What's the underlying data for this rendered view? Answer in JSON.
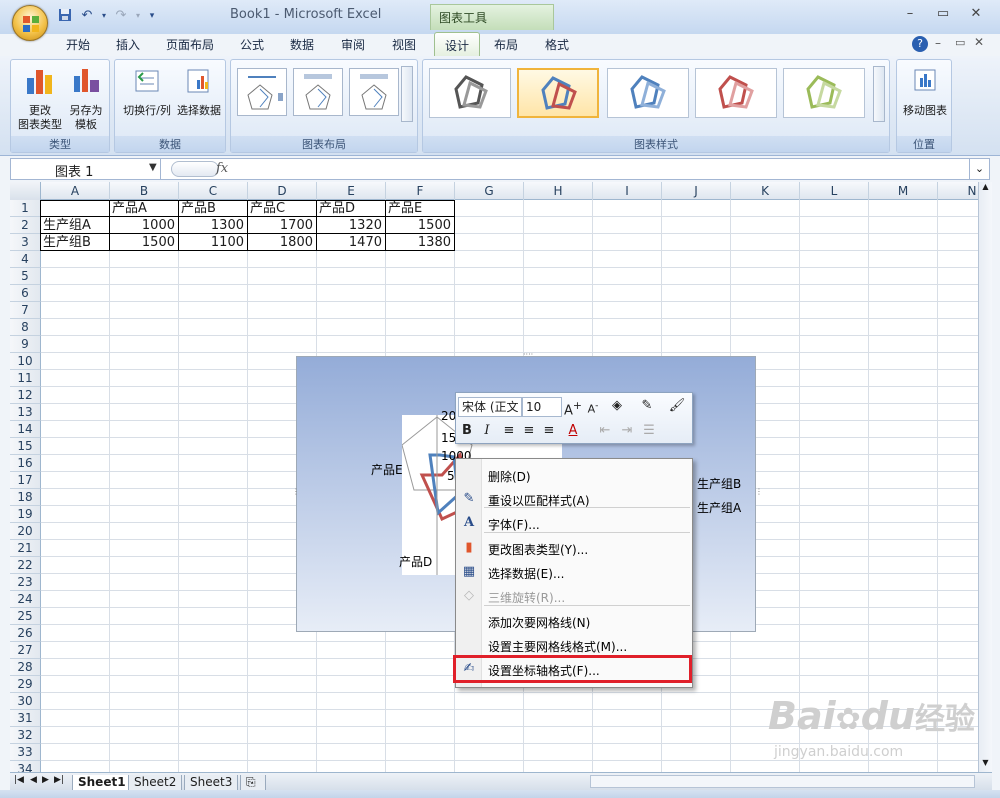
{
  "window": {
    "title": "Book1 - Microsoft Excel",
    "tools_tab": "图表工具"
  },
  "tabs": [
    "开始",
    "插入",
    "页面布局",
    "公式",
    "数据",
    "审阅",
    "视图",
    "设计",
    "布局",
    "格式"
  ],
  "ribbon": {
    "type_group": {
      "label": "类型",
      "change_type": "更改\n图表类型",
      "save_template": "另存为\n模板"
    },
    "data_group": {
      "label": "数据",
      "switch_row_col": "切换行/列",
      "select_data": "选择数据"
    },
    "layout_group": {
      "label": "图表布局"
    },
    "styles_group": {
      "label": "图表样式"
    },
    "location_group": {
      "label": "位置",
      "move_chart": "移动图表"
    }
  },
  "formula_bar": {
    "name_box": "图表 1",
    "fx": "fx"
  },
  "columns": [
    "A",
    "B",
    "C",
    "D",
    "E",
    "F",
    "G",
    "H",
    "I",
    "J",
    "K",
    "L",
    "M",
    "N"
  ],
  "rows": [
    "1",
    "2",
    "3",
    "4",
    "5",
    "6",
    "7",
    "8",
    "9",
    "10",
    "11",
    "12",
    "13",
    "14",
    "15",
    "16",
    "17",
    "18",
    "19",
    "20",
    "21",
    "22",
    "23",
    "24",
    "25",
    "26",
    "27",
    "28",
    "29",
    "30",
    "31",
    "32",
    "33",
    "34"
  ],
  "table": {
    "headers": [
      "产品A",
      "产品B",
      "产品C",
      "产品D",
      "产品E"
    ],
    "rows": [
      {
        "label": "生产组A",
        "values": [
          "1000",
          "1300",
          "1700",
          "1320",
          "1500"
        ]
      },
      {
        "label": "生产组B",
        "values": [
          "1500",
          "1100",
          "1800",
          "1470",
          "1380"
        ]
      }
    ]
  },
  "chart": {
    "axis_labels": [
      "2000",
      "150",
      "1000",
      "50"
    ],
    "category_labels": [
      "产品E",
      "产品D"
    ],
    "legend": [
      "生产组B",
      "生产组A"
    ],
    "series_colors": {
      "a": "#c0504d",
      "b": "#4f81bd"
    }
  },
  "mini_toolbar": {
    "font": "宋体 (正文",
    "size": "10",
    "bold": "B",
    "italic": "I"
  },
  "context_menu": [
    {
      "label": "删除(D)",
      "icon": "delete-icon",
      "enabled": true
    },
    {
      "label": "重设以匹配样式(A)",
      "icon": "reset-style-icon",
      "enabled": true
    },
    {
      "label": "字体(F)...",
      "icon": "font-icon",
      "enabled": true
    },
    {
      "label": "更改图表类型(Y)...",
      "icon": "chart-type-icon",
      "enabled": true
    },
    {
      "label": "选择数据(E)...",
      "icon": "select-data-icon",
      "enabled": true
    },
    {
      "label": "三维旋转(R)...",
      "icon": "rotate-3d-icon",
      "enabled": false
    },
    {
      "label": "添加次要网格线(N)",
      "icon": "",
      "enabled": true
    },
    {
      "label": "设置主要网格线格式(M)...",
      "icon": "",
      "enabled": true
    },
    {
      "label": "设置坐标轴格式(F)...",
      "icon": "format-axis-icon",
      "enabled": true
    }
  ],
  "sheet_tabs": [
    "Sheet1",
    "Sheet2",
    "Sheet3"
  ],
  "watermark": {
    "brand": "Bai",
    "brand2": "du",
    "cn": "经验",
    "url": "jingyan.baidu.com"
  }
}
